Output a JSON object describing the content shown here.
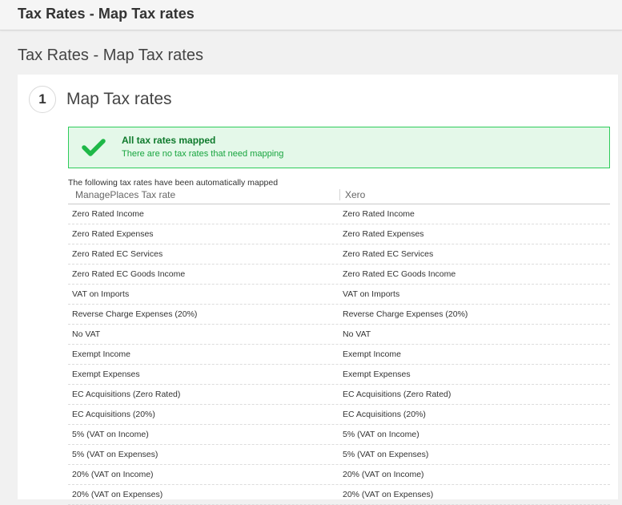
{
  "topbar": {
    "title": "Tax Rates - Map Tax rates"
  },
  "page": {
    "heading": "Tax Rates - Map Tax rates"
  },
  "step": {
    "number": "1",
    "title": "Map Tax rates"
  },
  "alert": {
    "icon": "checkmark-icon",
    "title": "All tax rates mapped",
    "subtitle": "There are no tax rates that need mapping",
    "colors": {
      "background": "#e4f8e9",
      "border": "#2ecc5a",
      "icon": "#1fb848"
    }
  },
  "mapping": {
    "intro": "The following tax rates have been automatically mapped",
    "columns": [
      "ManagePlaces Tax rate",
      "Xero"
    ],
    "rows": [
      [
        "Zero Rated Income",
        "Zero Rated Income"
      ],
      [
        "Zero Rated Expenses",
        "Zero Rated Expenses"
      ],
      [
        "Zero Rated EC Services",
        "Zero Rated EC Services"
      ],
      [
        "Zero Rated EC Goods Income",
        "Zero Rated EC Goods Income"
      ],
      [
        "VAT on Imports",
        "VAT on Imports"
      ],
      [
        "Reverse Charge Expenses (20%)",
        "Reverse Charge Expenses (20%)"
      ],
      [
        "No VAT",
        "No VAT"
      ],
      [
        "Exempt Income",
        "Exempt Income"
      ],
      [
        "Exempt Expenses",
        "Exempt Expenses"
      ],
      [
        "EC Acquisitions (Zero Rated)",
        "EC Acquisitions (Zero Rated)"
      ],
      [
        "EC Acquisitions (20%)",
        "EC Acquisitions (20%)"
      ],
      [
        "5% (VAT on Income)",
        "5% (VAT on Income)"
      ],
      [
        "5% (VAT on Expenses)",
        "5% (VAT on Expenses)"
      ],
      [
        "20% (VAT on Income)",
        "20% (VAT on Income)"
      ],
      [
        "20% (VAT on Expenses)",
        "20% (VAT on Expenses)"
      ]
    ]
  }
}
